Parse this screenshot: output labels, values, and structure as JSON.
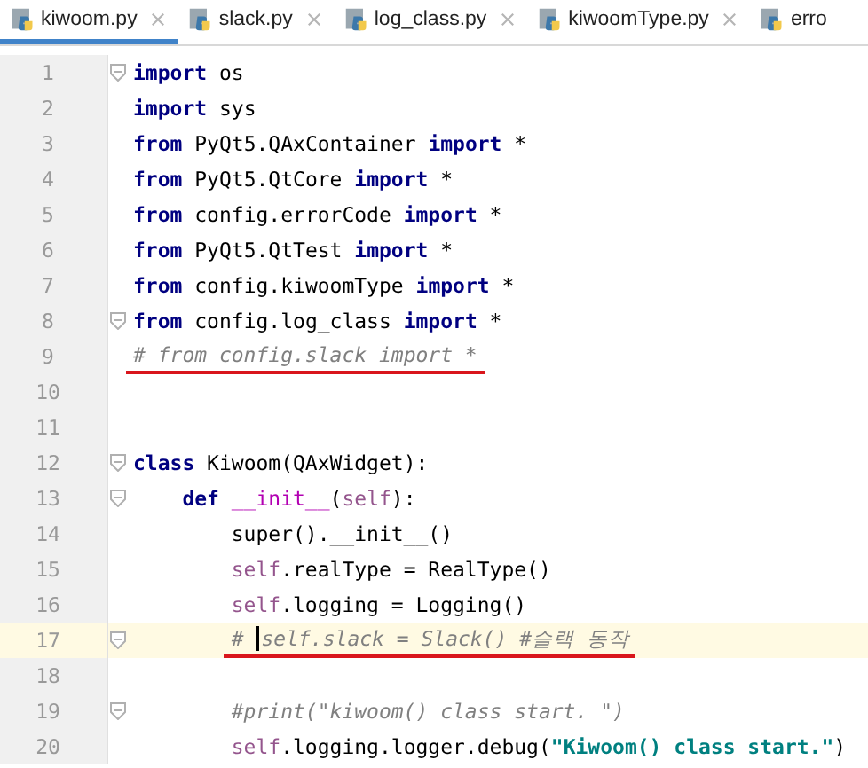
{
  "tabs": [
    {
      "label": "kiwoom.py",
      "selected": true
    },
    {
      "label": "slack.py",
      "selected": false
    },
    {
      "label": "log_class.py",
      "selected": false
    },
    {
      "label": "kiwoomType.py",
      "selected": false
    },
    {
      "label": "erro",
      "selected": false
    }
  ],
  "editor": {
    "lines": [
      {
        "number": "1",
        "fold": true,
        "current": false,
        "underlined": false,
        "tokens": [
          {
            "t": "import",
            "kind": "kw"
          },
          {
            "t": " os",
            "kind": "plain"
          }
        ]
      },
      {
        "number": "2",
        "fold": false,
        "current": false,
        "underlined": false,
        "tokens": [
          {
            "t": "import",
            "kind": "kw"
          },
          {
            "t": " sys",
            "kind": "plain"
          }
        ]
      },
      {
        "number": "3",
        "fold": false,
        "current": false,
        "underlined": false,
        "tokens": [
          {
            "t": "from",
            "kind": "kw"
          },
          {
            "t": " PyQt5.QAxContainer ",
            "kind": "plain"
          },
          {
            "t": "import",
            "kind": "kw"
          },
          {
            "t": " *",
            "kind": "plain"
          }
        ]
      },
      {
        "number": "4",
        "fold": false,
        "current": false,
        "underlined": false,
        "tokens": [
          {
            "t": "from",
            "kind": "kw"
          },
          {
            "t": " PyQt5.QtCore ",
            "kind": "plain"
          },
          {
            "t": "import",
            "kind": "kw"
          },
          {
            "t": " *",
            "kind": "plain"
          }
        ]
      },
      {
        "number": "5",
        "fold": false,
        "current": false,
        "underlined": false,
        "tokens": [
          {
            "t": "from",
            "kind": "kw"
          },
          {
            "t": " config.errorCode ",
            "kind": "plain"
          },
          {
            "t": "import",
            "kind": "kw"
          },
          {
            "t": " *",
            "kind": "plain"
          }
        ]
      },
      {
        "number": "6",
        "fold": false,
        "current": false,
        "underlined": false,
        "tokens": [
          {
            "t": "from",
            "kind": "kw"
          },
          {
            "t": " PyQt5.QtTest ",
            "kind": "plain"
          },
          {
            "t": "import",
            "kind": "kw"
          },
          {
            "t": " *",
            "kind": "plain"
          }
        ]
      },
      {
        "number": "7",
        "fold": false,
        "current": false,
        "underlined": false,
        "tokens": [
          {
            "t": "from",
            "kind": "kw"
          },
          {
            "t": " config.kiwoomType ",
            "kind": "plain"
          },
          {
            "t": "import",
            "kind": "kw"
          },
          {
            "t": " *",
            "kind": "plain"
          }
        ]
      },
      {
        "number": "8",
        "fold": true,
        "current": false,
        "underlined": false,
        "tokens": [
          {
            "t": "from",
            "kind": "kw"
          },
          {
            "t": " config.log_class ",
            "kind": "plain"
          },
          {
            "t": "import",
            "kind": "kw"
          },
          {
            "t": " *",
            "kind": "plain"
          }
        ]
      },
      {
        "number": "9",
        "fold": false,
        "current": false,
        "underlined": true,
        "tokens": [
          {
            "t": "# from config.slack import *",
            "kind": "comment"
          }
        ]
      },
      {
        "number": "10",
        "fold": false,
        "current": false
      },
      {
        "number": "11",
        "fold": false,
        "current": false
      },
      {
        "number": "12",
        "fold": true,
        "current": false,
        "underlined": false,
        "tokens": [
          {
            "t": "class",
            "kind": "kw"
          },
          {
            "t": " Kiwoom(QAxWidget):",
            "kind": "plain"
          }
        ],
        "children": [
          {
            "number": "13",
            "fold": true,
            "current": false,
            "underlined": false,
            "tokens": [
              {
                "t": "def",
                "kind": "kw"
              },
              {
                "t": " __init__",
                "kind": "magic"
              },
              {
                "t": "(",
                "kind": "plain"
              },
              {
                "t": "self",
                "kind": "self"
              },
              {
                "t": "):",
                "kind": "plain"
              }
            ],
            "children": [
              {
                "number": "14",
                "fold": false,
                "current": false,
                "underlined": false,
                "tokens": [
                  {
                    "t": "super().__init__()",
                    "kind": "plain"
                  }
                ]
              },
              {
                "number": "15",
                "fold": false,
                "current": false,
                "underlined": false,
                "tokens": [
                  {
                    "t": "self",
                    "kind": "self"
                  },
                  {
                    "t": ".realType = RealType()",
                    "kind": "plain"
                  }
                ]
              },
              {
                "number": "16",
                "fold": false,
                "current": false,
                "underlined": false,
                "tokens": [
                  {
                    "t": "self",
                    "kind": "self"
                  },
                  {
                    "t": ".logging = Logging()",
                    "kind": "plain"
                  }
                ]
              },
              {
                "number": "17",
                "fold": true,
                "current": true,
                "underlined": true,
                "tokens": [
                  {
                    "t": "# ",
                    "kind": "comment"
                  },
                  {
                    "t": "self.slack = Slack() #슬랙 동작",
                    "kind": "comment",
                    "caret": true
                  }
                ]
              },
              {
                "number": "18",
                "fold": false,
                "current": false
              },
              {
                "number": "19",
                "fold": true,
                "current": false,
                "underlined": false,
                "tokens": [
                  {
                    "t": "#print(\"kiwoom() class start. \")",
                    "kind": "comment"
                  }
                ]
              },
              {
                "number": "20",
                "fold": false,
                "current": false,
                "underlined": false,
                "tokens": [
                  {
                    "t": "self",
                    "kind": "self"
                  },
                  {
                    "t": ".logging.logger.debug(",
                    "kind": "plain"
                  },
                  {
                    "t": "\"Kiwoom() class start.\"",
                    "kind": "str"
                  },
                  {
                    "t": ")",
                    "kind": "plain"
                  }
                ]
              }
            ]
          }
        ]
      }
    ]
  }
}
